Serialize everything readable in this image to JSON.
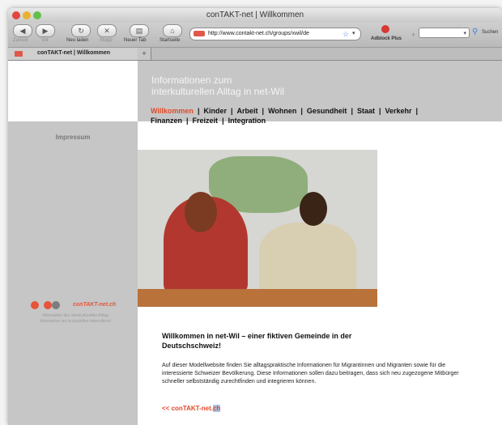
{
  "window": {
    "title": "conTAKT-net | Willkommen"
  },
  "toolbar": {
    "back_label": "Zurück",
    "forward_label": "Vor",
    "reload_label": "Neu laden",
    "stop_label": "Stopp",
    "newtab_label": "Neuer Tab",
    "home_label": "Startseite",
    "url": "http://www.contakt-net.ch/groups/xwil/de",
    "adblock_label": "Adblock Plus",
    "search_label": "Suchen"
  },
  "tabs": [
    {
      "label": "conTAKT-net | Willkommen"
    }
  ],
  "header": {
    "title_line1": "Informationen zum",
    "title_line2": "interkulturellen Alltag in net-Wil"
  },
  "nav": [
    {
      "label": "Willkommen",
      "active": true
    },
    {
      "label": "Kinder"
    },
    {
      "label": "Arbeit"
    },
    {
      "label": "Wohnen"
    },
    {
      "label": "Gesundheit"
    },
    {
      "label": "Staat"
    },
    {
      "label": "Verkehr"
    },
    {
      "label": "Finanzen"
    },
    {
      "label": "Freizeit"
    },
    {
      "label": "Integration"
    }
  ],
  "sidebar": {
    "impressum": "Impressum",
    "logo_text": "conTAKT-net.ch",
    "tagline_line1": "Information tips interkulturellen Alltag",
    "tagline_line2": "Information sur le quotidien interculturel"
  },
  "main": {
    "welcome_title": "Willkommen in net-Wil – einer fiktiven Gemeinde in der Deutschschweiz!",
    "welcome_text": "Auf dieser Modellwebsite finden Sie alltagspraktische Informationen für Migrantinnen und Migranten sowie für die interessierte Schweizer Bevölkerung. Diese Informationen sollen dazu beitragen, dass sich neu zugezogene Mitbürger schneller selbstständig zurechtfinden und integrieren können.",
    "back_link_prefix": "<< conTAKT-net.",
    "back_link_hl": "ch"
  },
  "colors": {
    "accent": "#e04a2a",
    "header_bg": "#c6c6c6"
  }
}
